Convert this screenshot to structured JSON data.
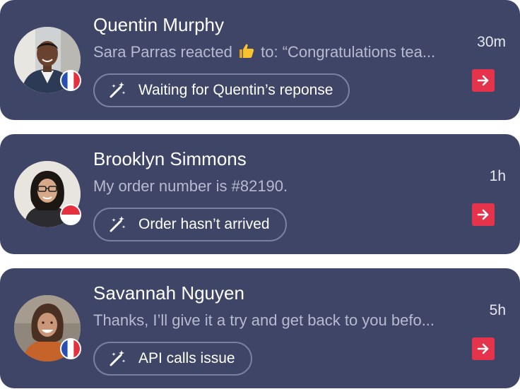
{
  "conversations": [
    {
      "name": "Quentin Murphy",
      "preview_prefix": "Sara Parras reacted",
      "preview_emoji": "thumbs-up",
      "preview_suffix": "to: “Congratulations tea...",
      "time": "30m",
      "tag": "Waiting for Quentin’s reponse",
      "flag": "France"
    },
    {
      "name": "Brooklyn Simmons",
      "preview": "My order number is #82190.",
      "time": "1h",
      "tag": "Order hasn’t arrived",
      "flag": "Indonesia"
    },
    {
      "name": "Savannah Nguyen",
      "preview": "Thanks, I’ll give it a try and get back to you befo...",
      "time": "5h",
      "tag": "API calls issue",
      "flag": "France"
    }
  ],
  "colors": {
    "card_background": "#3e4566",
    "accent_red": "#e5334b",
    "tag_border": "#7a80a2",
    "preview_text": "#b7bbcf"
  },
  "icons": {
    "tag_icon": "magic-wand-icon",
    "action_icon": "arrow-right-icon"
  }
}
